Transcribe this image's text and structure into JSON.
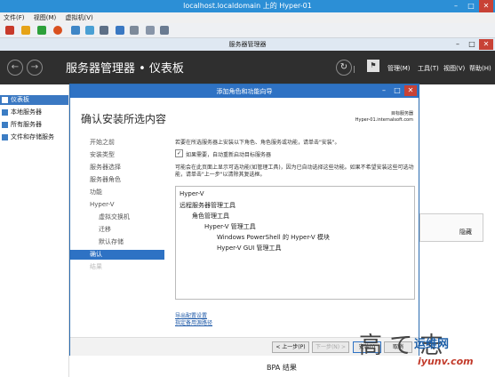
{
  "vm_window": {
    "title": "localhost.localdomain 上的 Hyper-01",
    "menu": [
      "文件(F)",
      "视图(M)",
      "虚拟机(V)"
    ],
    "controls": [
      "–",
      "□",
      "✕"
    ]
  },
  "server_manager": {
    "title": "服务器管理器",
    "controls": [
      "–",
      "□",
      "✕"
    ],
    "breadcrumb": "服务器管理器 • 仪表板",
    "menu": {
      "manage": "管理(M)",
      "tools": "工具(T)",
      "view": "视图(V)",
      "help": "帮助(H)"
    },
    "sidebar": [
      "仪表板",
      "本地服务器",
      "所有服务器",
      "文件和存储服务"
    ],
    "hide_label": "隐藏",
    "bpa_label": "BPA 结果"
  },
  "wizard": {
    "title": "添加角色和功能向导",
    "heading": "确认安装所选内容",
    "dest_label": "目标服务器",
    "dest_server": "Hyper-01.internalsoft.com",
    "steps": [
      "开始之前",
      "安装类型",
      "服务器选择",
      "服务器角色",
      "功能",
      "Hyper-V",
      "虚拟交换机",
      "迁移",
      "默认存储",
      "确认",
      "结果"
    ],
    "intro": "若要在所选服务器上安装以下角色、角色服务或功能，请单击\"安装\"。",
    "checkbox_label": "如果需要，自动重新启动目标服务器",
    "note_line1": "可能会在此页面上显示可选功能(如管理工具)，因为已自动选择这些功能。如果不希望安装这些可选功",
    "note_line2": "能，请单击\"上一步\"以清除其复选框。",
    "tree": [
      "Hyper-V",
      "远程服务器管理工具",
      "角色管理工具",
      "Hyper-V 管理工具",
      "Windows PowerShell 的 Hyper-V 模块",
      "Hyper-V GUI 管理工具"
    ],
    "links": [
      "导出配置设置",
      "指定备用源路径"
    ],
    "buttons": {
      "prev": "< 上一步(P)",
      "next": "下一步(N) >",
      "install": "安装(I)",
      "cancel": "取消"
    }
  },
  "watermark": {
    "text": "运维网",
    "url": "iyunv.com",
    "glyphs": "高 て 志"
  },
  "colors": {
    "vm_titlebar": "#2c8fd6",
    "wizard_titlebar": "#2e72c4",
    "sm_header": "#2f2f2f",
    "selection": "#3a78c2"
  }
}
